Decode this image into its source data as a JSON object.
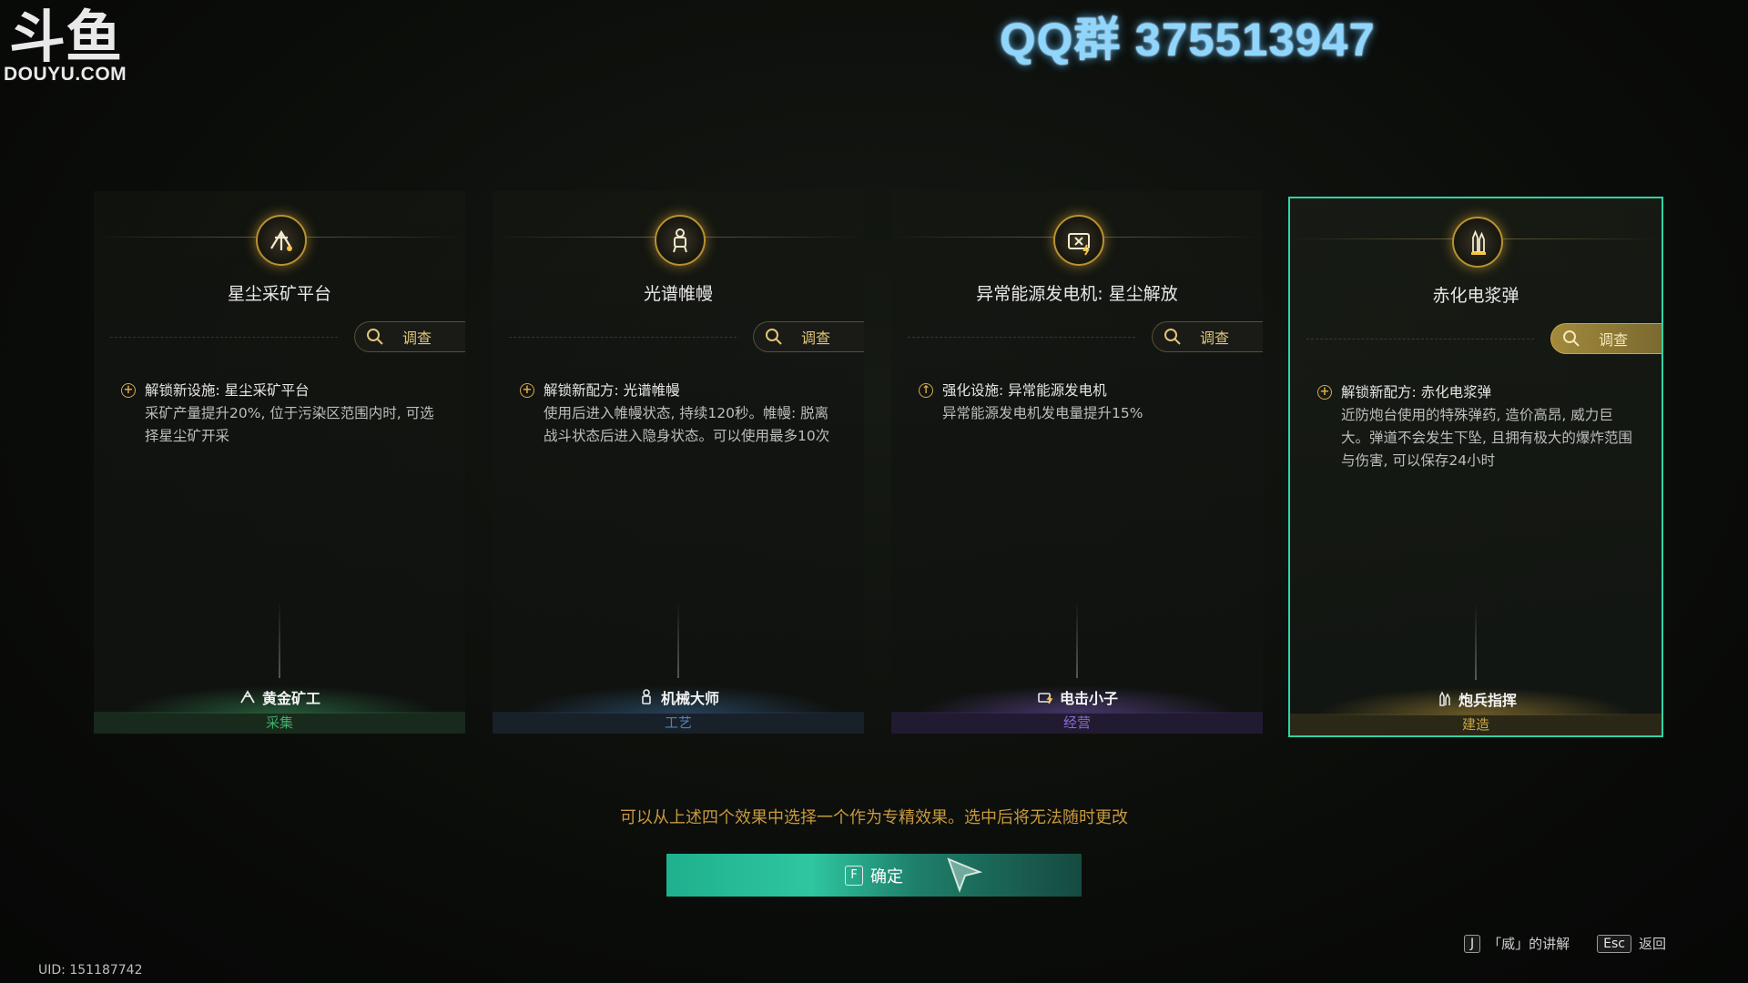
{
  "watermark": {
    "logo_chars": "斗鱼",
    "site": "DOUYU.COM"
  },
  "banner": {
    "text": "QQ群 375513947"
  },
  "cards": [
    {
      "title": "星尘采矿平台",
      "investigate_label": "调查",
      "effect_head": "解锁新设施: 星尘采矿平台",
      "effect_body": "采矿产量提升20%, 位于污染区范围内时, 可选择星尘矿开采",
      "hero": "黄金矿工",
      "category": "采集",
      "accent": "#3fae6a",
      "selected": false
    },
    {
      "title": "光谱帷幔",
      "investigate_label": "调查",
      "effect_head": "解锁新配方: 光谱帷幔",
      "effect_body": "使用后进入帷幔状态, 持续120秒。帷幔: 脱离战斗状态后进入隐身状态。可以使用最多10次",
      "hero": "机械大师",
      "category": "工艺",
      "accent": "#3f7bb0",
      "selected": false
    },
    {
      "title": "异常能源发电机: 星尘解放",
      "investigate_label": "调查",
      "effect_head": "强化设施: 异常能源发电机",
      "effect_body": "异常能源发电机发电量提升15%",
      "hero": "电击小子",
      "category": "经营",
      "accent": "#7b5bc0",
      "selected": false
    },
    {
      "title": "赤化电浆弹",
      "investigate_label": "调查",
      "effect_head": "解锁新配方: 赤化电浆弹",
      "effect_body": "近防炮台使用的特殊弹药, 造价高昂, 威力巨大。弹道不会发生下坠, 且拥有极大的爆炸范围与伤害, 可以保存24小时",
      "hero": "炮兵指挥",
      "category": "建造",
      "accent": "#c9a441",
      "selected": true
    }
  ],
  "instruction": "可以从上述四个效果中选择一个作为专精效果。选中后将无法随时更改",
  "confirm": {
    "key": "F",
    "label": "确定"
  },
  "hints": [
    {
      "key": "J",
      "label": "「威」的讲解"
    },
    {
      "key": "Esc",
      "label": "返回"
    }
  ],
  "uid": "UID: 151187742",
  "colors": {
    "selection_border": "#2fd4a6",
    "gold": "#c7993f"
  }
}
